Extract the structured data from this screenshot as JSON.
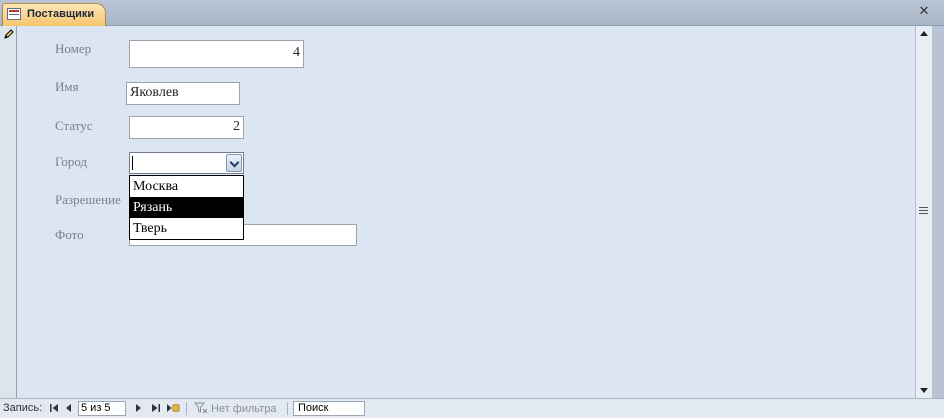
{
  "tab": {
    "title": "Поставщики",
    "close_glyph": "✕"
  },
  "form": {
    "fields": [
      {
        "label": "Номер",
        "value": "4"
      },
      {
        "label": "Имя",
        "value": "Яковлев"
      },
      {
        "label": "Статус",
        "value": "2"
      },
      {
        "label": "Город",
        "value": ""
      },
      {
        "label": "Разрешение",
        "value": ""
      },
      {
        "label": "Фото",
        "value": ""
      }
    ],
    "city_options": [
      "Москва",
      "Рязань",
      "Тверь"
    ],
    "highlighted_option": "Рязань"
  },
  "navigation": {
    "label": "Запись:",
    "record_position": "5 из 5",
    "filter_label": "Нет фильтра",
    "search_placeholder": "Поиск"
  },
  "icons": [
    "form-icon",
    "close-icon",
    "pencil-icon",
    "scroll-up-icon",
    "scroll-down-icon",
    "first-record-icon",
    "previous-record-icon",
    "next-record-icon",
    "last-record-icon",
    "new-record-icon",
    "filter-icon"
  ]
}
